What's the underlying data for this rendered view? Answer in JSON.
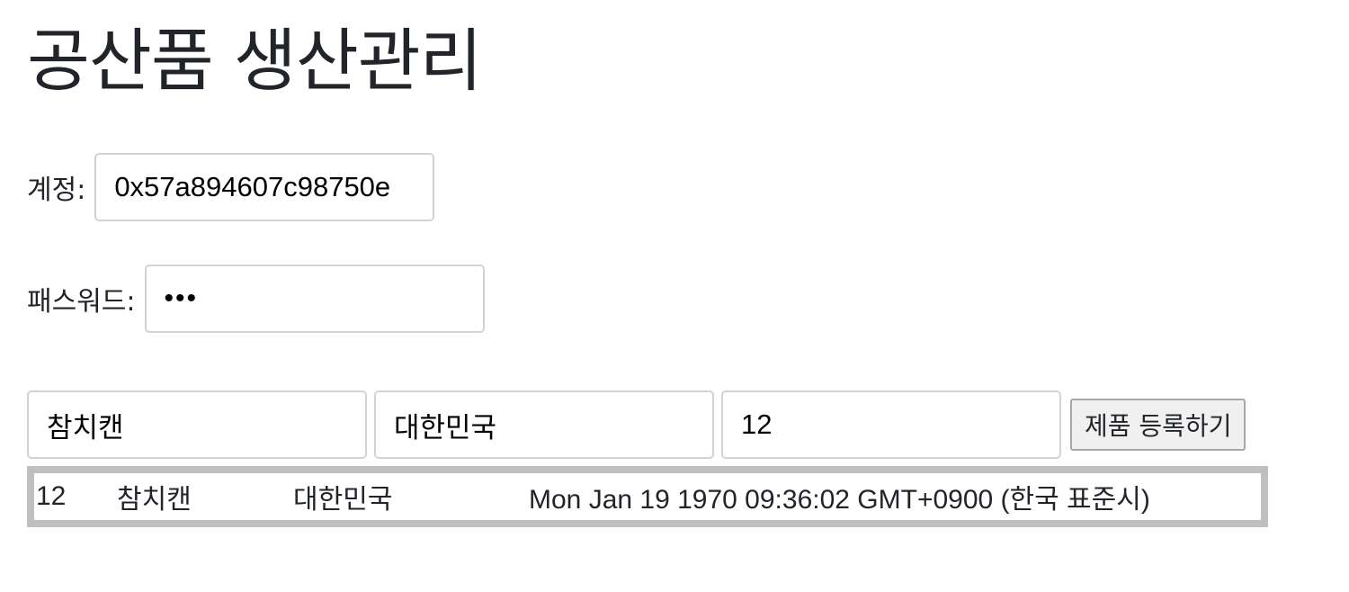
{
  "page": {
    "title": "공산품 생산관리"
  },
  "account": {
    "label": "계정:",
    "value": "0x57a894607c98750e"
  },
  "password": {
    "label": "패스워드:",
    "value": "•••"
  },
  "product_form": {
    "name_value": "참치캔",
    "origin_value": "대한민국",
    "quantity_value": "12",
    "register_label": "제품 등록하기"
  },
  "products": [
    {
      "id": "12",
      "name": "참치캔",
      "origin": "대한민국",
      "date": "Mon Jan 19 1970 09:36:02 GMT+0900 (한국 표준시)"
    }
  ],
  "colors": {
    "text": "#212529",
    "input_border": "#ced4da",
    "table_border": "#bfbfbf",
    "button_bg": "#f0f0f0"
  }
}
